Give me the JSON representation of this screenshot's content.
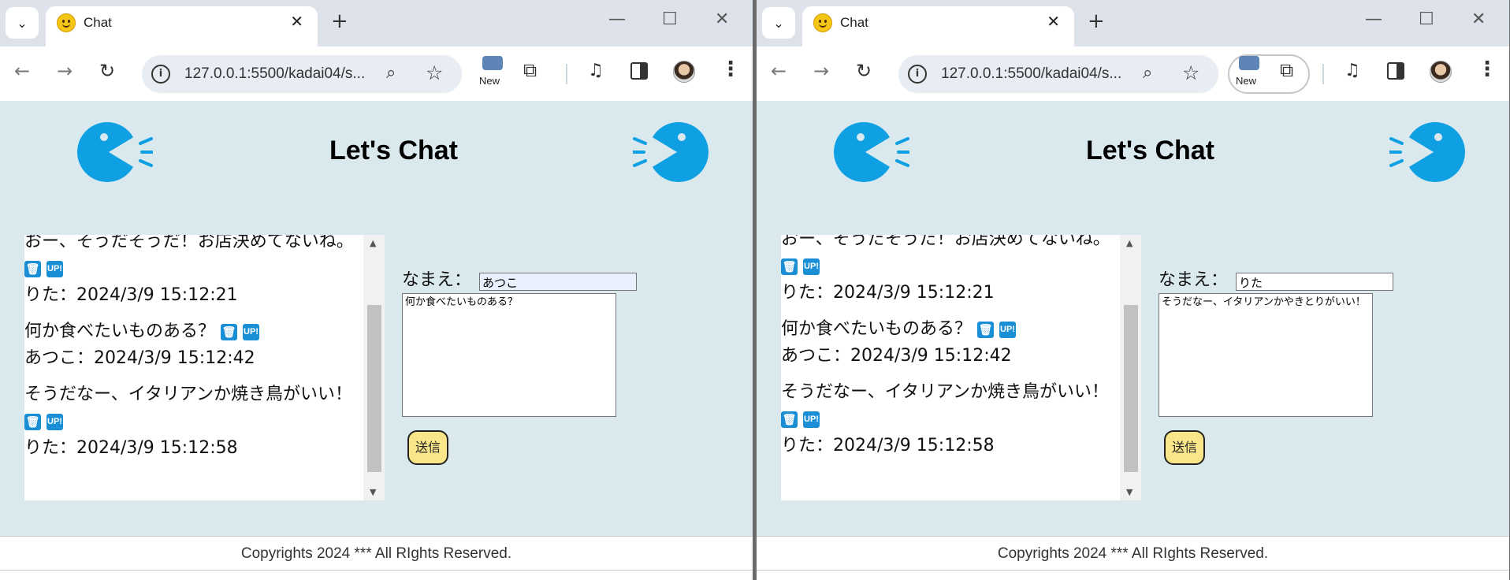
{
  "windows": [
    {
      "tab_title": "Chat",
      "url": "127.0.0.1:5500/kadai04/s...",
      "extension_label": "New",
      "page_title": "Let's Chat",
      "messages": [
        {
          "text": "おー、そうだそうだ！お店決めてないね。",
          "meta": "りた：2024/3/9 15:12:21"
        },
        {
          "text": "何か食べたいものある？",
          "meta": "あつこ：2024/3/9 15:12:42"
        },
        {
          "text": "そうだなー、イタリアンか焼き鳥がいい！",
          "meta": "りた：2024/3/9 15:12:58"
        }
      ],
      "name_label": "なまえ：",
      "name_value": "あつこ",
      "message_value": "何か食べたいものある？",
      "send_label": "送信",
      "footer": "Copyrights 2024 *** All RIghts Reserved."
    },
    {
      "tab_title": "Chat",
      "url": "127.0.0.1:5500/kadai04/s...",
      "extension_label": "New",
      "page_title": "Let's Chat",
      "messages": [
        {
          "text": "おー、そうだそうだ！お店決めてないね。",
          "meta": "りた：2024/3/9 15:12:21"
        },
        {
          "text": "何か食べたいものある？",
          "meta": "あつこ：2024/3/9 15:12:42"
        },
        {
          "text": "そうだなー、イタリアンか焼き鳥がいい！",
          "meta": "りた：2024/3/9 15:12:58"
        }
      ],
      "name_label": "なまえ：",
      "name_value": "りた",
      "message_value": "そうだなー、イタリアンかやきとりがいい！",
      "send_label": "送信",
      "footer": "Copyrights 2024 *** All RIghts Reserved."
    }
  ],
  "icons": {
    "badge_delete": "trash-icon",
    "badge_up": "UP!",
    "mascot": "chat-mascot"
  },
  "colors": {
    "page_bg": "#dae9ee",
    "mascot_blue": "#0ea0e3",
    "badge_blue": "#1b8fd6",
    "send_button": "#f9e58a"
  }
}
